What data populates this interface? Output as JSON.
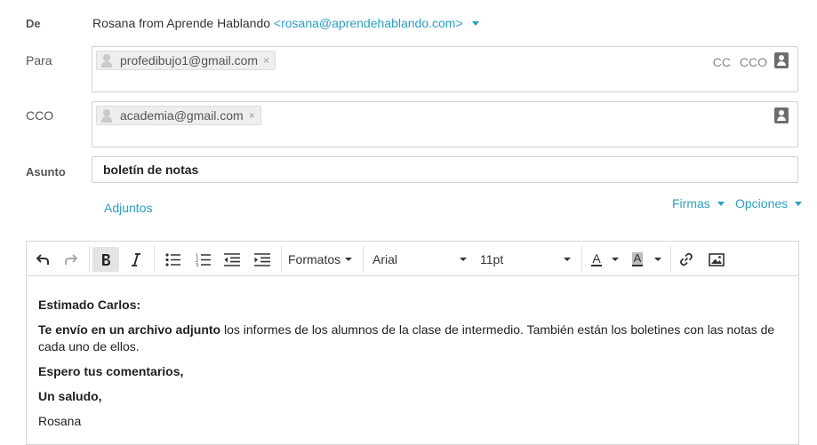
{
  "header": {
    "from_label": "De",
    "from_name": "Rosana from Aprende Hablando",
    "from_email": "<rosana@aprendehablando.com>",
    "to_label": "Para",
    "to_chip": "profedibujo1@gmail.com",
    "cc_link": "CC",
    "cco_link": "CCO",
    "bcc_label": "CCO",
    "bcc_chip": "academia@gmail.com",
    "subject_label": "Asunto",
    "subject_value": "boletín de notas",
    "attachments_link": "Adjuntos",
    "signatures_link": "Firmas",
    "options_link": "Opciones"
  },
  "toolbar": {
    "formats_label": "Formatos",
    "font_value": "Arial",
    "size_value": "11pt",
    "text_color_glyph": "A",
    "bg_color_glyph": "A",
    "chip_remove_glyph": "×"
  },
  "body": {
    "greeting": "Estimado Carlos:",
    "p1_bold": "Te envío en un archivo adjunto",
    "p1_rest": " los informes de los alumnos de la clase de intermedio. También están los boletines con las notas de cada uno de ellos.",
    "p2": "Espero tus comentarios,",
    "p3": "Un saludo,",
    "signature": "Rosana"
  },
  "colors": {
    "accent": "#2a9fc4",
    "border": "#cfcfcf",
    "active_button": "#e4e4e4"
  }
}
